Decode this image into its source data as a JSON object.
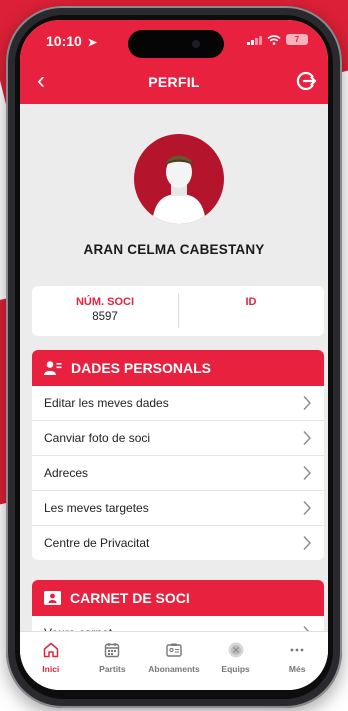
{
  "status_bar": {
    "time": "10:10",
    "battery": "7"
  },
  "header": {
    "title": "PERFIL"
  },
  "profile": {
    "name": "ARAN CELMA CABESTANY"
  },
  "member_card": {
    "number_label": "NÚM. SOCI",
    "number_value": "8597",
    "id_label": "ID"
  },
  "personal_section": {
    "title": "DADES PERSONALS",
    "items": [
      {
        "label": "Editar les meves dades"
      },
      {
        "label": "Canviar foto de soci"
      },
      {
        "label": "Adreces"
      },
      {
        "label": "Les meves targetes"
      },
      {
        "label": "Centre de Privacitat"
      }
    ]
  },
  "card_section": {
    "title": "CARNET DE SOCI",
    "items": [
      {
        "label": "Veure carnet"
      }
    ]
  },
  "tabbar": {
    "tabs": [
      {
        "label": "Inici",
        "icon": "home-icon"
      },
      {
        "label": "Partits",
        "icon": "calendar-icon"
      },
      {
        "label": "Abonaments",
        "icon": "ticket-icon"
      },
      {
        "label": "Equips",
        "icon": "team-icon"
      },
      {
        "label": "Més",
        "icon": "more-icon"
      }
    ]
  },
  "colors": {
    "accent": "#e8213f",
    "background": "#ececec"
  }
}
